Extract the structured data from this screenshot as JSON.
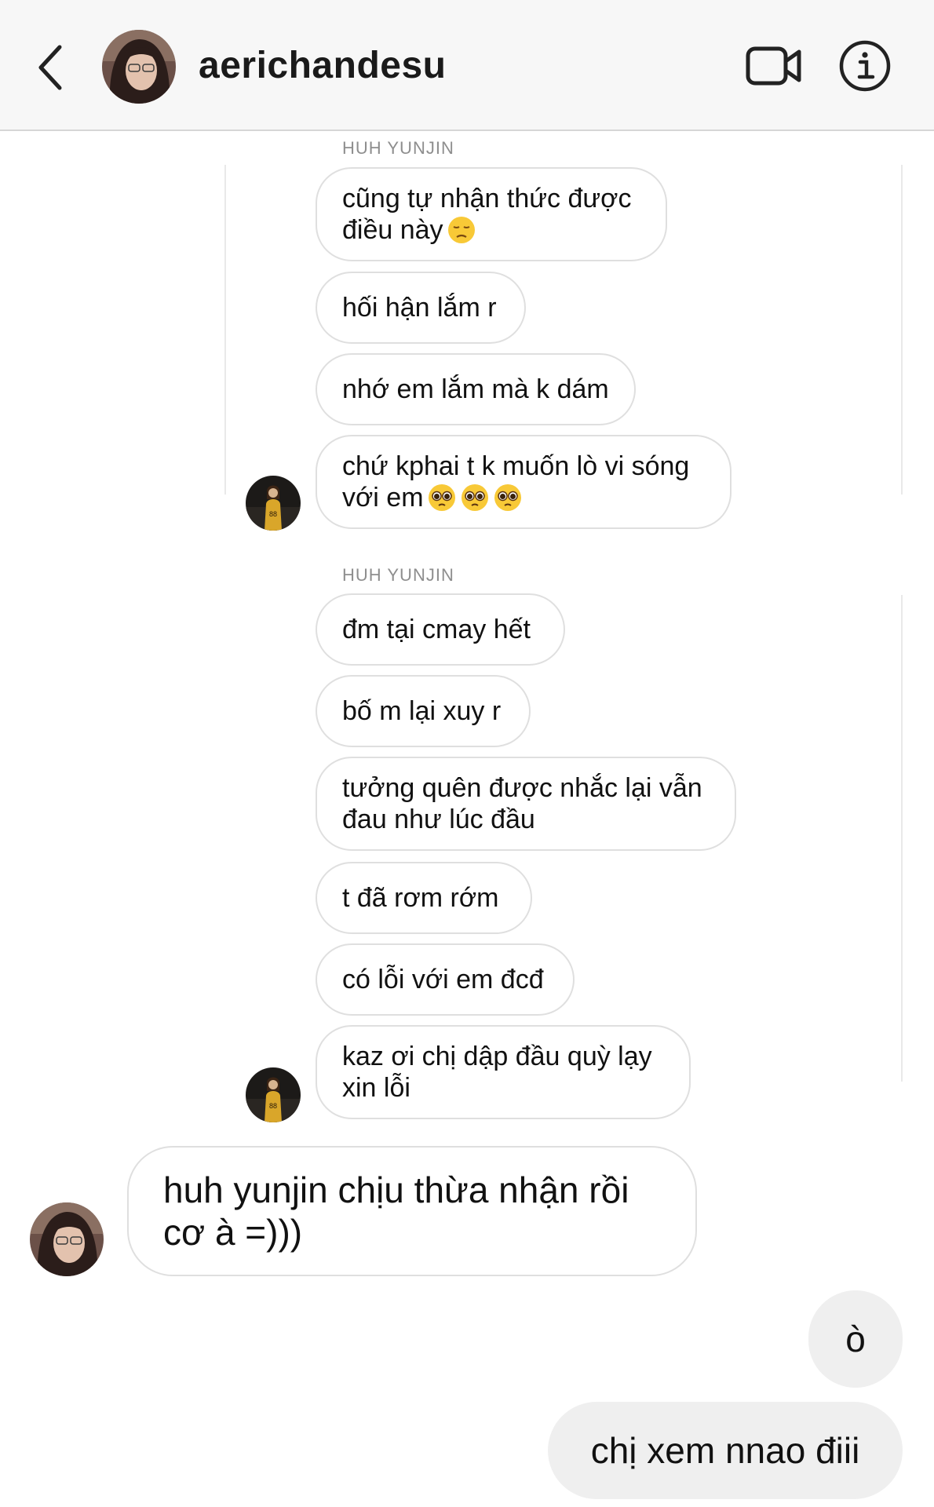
{
  "header": {
    "username": "aerichandesu"
  },
  "thread": {
    "replies": [
      {
        "sender_label": "HUH YUNJIN",
        "messages": [
          {
            "text": "cũng tự nhận thức được\nđiều này",
            "emoji": "pensive-face"
          },
          {
            "text": "hối hận lắm r"
          },
          {
            "text": "nhớ em lắm mà k dám"
          },
          {
            "text": "chứ kphai t k muốn lò vi sóng\nvới em",
            "emoji": "pleading-face x3"
          }
        ]
      },
      {
        "sender_label": "HUH YUNJIN",
        "messages": [
          {
            "text": "đm tại cmay hết"
          },
          {
            "text": "bố m lại xuy r"
          },
          {
            "text": "tưởng quên được nhắc lại vẫn\nđau như lúc đầu"
          },
          {
            "text": "t đã rơm rớm"
          },
          {
            "text": "có lỗi với em đcđ"
          },
          {
            "text": "kaz ơi chị dập đầu quỳ lạy\nxin lỗi"
          }
        ]
      }
    ],
    "incoming": {
      "text": "huh yunjin chịu thừa nhận rồi\ncơ à =)))"
    },
    "outgoing": [
      {
        "text": "ò"
      },
      {
        "text": "chị xem nnao điii"
      }
    ]
  },
  "colors": {
    "header_bg": "#f7f7f7",
    "bubble_border": "#dfdfdf",
    "outgoing_bg": "#efefef",
    "label_gray": "#8e8e8e"
  }
}
